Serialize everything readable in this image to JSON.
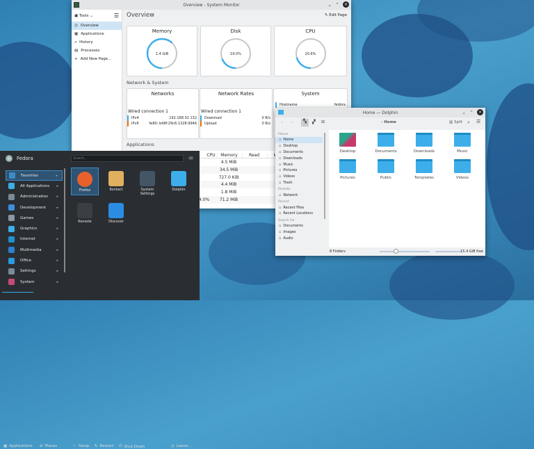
{
  "sysmon": {
    "title": "Overview - System Monitor",
    "tools": "Tools",
    "page_title": "Overview",
    "edit_page": "Edit Page",
    "sidebar": [
      "Overview",
      "Applications",
      "History",
      "Processes",
      "Add New Page..."
    ],
    "gauges": [
      {
        "title": "Memory",
        "value": "1.4 GiB",
        "fraction": 0.62
      },
      {
        "title": "Disk",
        "value": "19.0%",
        "fraction": 0.19
      },
      {
        "title": "CPU",
        "value": "20.6%",
        "fraction": 0.206
      }
    ],
    "net_section": "Network & System",
    "networks": {
      "title": "Networks",
      "conn": "Wired connection 1",
      "rows": [
        {
          "k": "IPv4",
          "v": "192.168.32.132"
        },
        {
          "k": "IPv6",
          "v": "fe80::b48f:29c6:1328:9946"
        }
      ]
    },
    "rates": {
      "title": "Network Rates",
      "conn": "Wired connection 1",
      "rows": [
        {
          "k": "Download",
          "v": "0 B/s"
        },
        {
          "k": "Upload",
          "v": "0 B/s"
        }
      ]
    },
    "system": {
      "title": "System",
      "rows": [
        {
          "k": "Hostname",
          "v": "fedora"
        }
      ]
    },
    "apps_section": "Applications",
    "table_headers": [
      "CPU",
      "Memory",
      "Read",
      "Write"
    ],
    "table_rows": [
      {
        "cpu": "",
        "mem": "4.5 MiB"
      },
      {
        "cpu": "",
        "mem": "34.5 MiB"
      },
      {
        "cpu": "",
        "mem": "727.0 KiB"
      },
      {
        "cpu": "",
        "mem": "4.4 MiB"
      },
      {
        "cpu": "",
        "mem": "1.8 MiB"
      },
      {
        "cpu": "4.0%",
        "mem": "71.2 MiB"
      }
    ]
  },
  "launcher": {
    "user": "Fedora",
    "search_placeholder": "Search...",
    "categories": [
      {
        "label": "Favorites",
        "color": "#3d8bc9"
      },
      {
        "label": "All Applications",
        "color": "#3daee9"
      },
      {
        "label": "Administration",
        "color": "#7a8a99"
      },
      {
        "label": "Development",
        "color": "#3b8ee0"
      },
      {
        "label": "Games",
        "color": "#8a96a3"
      },
      {
        "label": "Graphics",
        "color": "#3daee9"
      },
      {
        "label": "Internet",
        "color": "#1e90d0"
      },
      {
        "label": "Multimedia",
        "color": "#2d7fd0"
      },
      {
        "label": "Office",
        "color": "#2b9be0"
      },
      {
        "label": "Settings",
        "color": "#7a8a99"
      },
      {
        "label": "System",
        "color": "#c94a7a"
      }
    ],
    "apps": [
      {
        "label": "Firefox",
        "color": "#e8612c"
      },
      {
        "label": "Kontact",
        "color": "#e0b060"
      },
      {
        "label": "System Settings",
        "color": "#445566"
      },
      {
        "label": "Dolphin",
        "color": "#3daee9"
      },
      {
        "label": "Konsole",
        "color": "#3a3f44"
      },
      {
        "label": "Discover",
        "color": "#2b8de0"
      }
    ],
    "footer": {
      "applications": "Applications",
      "places": "Places",
      "sleep": "Sleep",
      "restart": "Restart",
      "shutdown": "Shut Down",
      "leave": "Leave..."
    }
  },
  "dolphin": {
    "title": "Home — Dolphin",
    "breadcrumb": "Home",
    "split": "Split",
    "places": [
      {
        "section": "Places",
        "items": [
          "Home",
          "Desktop",
          "Documents",
          "Downloads",
          "Music",
          "Pictures",
          "Videos",
          "Trash"
        ]
      },
      {
        "section": "Remote",
        "items": [
          "Network"
        ]
      },
      {
        "section": "Recent",
        "items": [
          "Recent Files",
          "Recent Locations"
        ]
      },
      {
        "section": "Search For",
        "items": [
          "Documents",
          "Images",
          "Audio"
        ]
      }
    ],
    "folders": [
      "Desktop",
      "Documents",
      "Downloads",
      "Music",
      "Pictures",
      "Public",
      "Templates",
      "Videos"
    ],
    "status": "8 Folders",
    "free": "15.4 GiB free"
  }
}
